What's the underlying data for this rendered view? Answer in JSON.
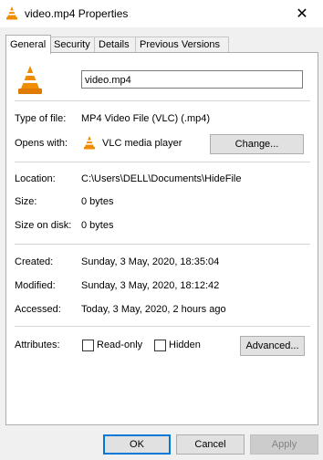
{
  "window": {
    "title": "video.mp4 Properties",
    "close_glyph": "✕"
  },
  "tabs": [
    {
      "label": "General",
      "active": true
    },
    {
      "label": "Security",
      "active": false
    },
    {
      "label": "Details",
      "active": false
    },
    {
      "label": "Previous Versions",
      "active": false
    }
  ],
  "general": {
    "file_name": "video.mp4",
    "type_label": "Type of file:",
    "type_value": "MP4 Video File (VLC) (.mp4)",
    "opens_label": "Opens with:",
    "opens_value": "VLC media player",
    "change_button": "Change...",
    "location_label": "Location:",
    "location_value": "C:\\Users\\DELL\\Documents\\HideFile",
    "size_label": "Size:",
    "size_value": "0 bytes",
    "size_on_disk_label": "Size on disk:",
    "size_on_disk_value": "0 bytes",
    "created_label": "Created:",
    "created_value": "Sunday, 3 May, 2020, 18:35:04",
    "modified_label": "Modified:",
    "modified_value": "Sunday, 3 May, 2020, 18:12:42",
    "accessed_label": "Accessed:",
    "accessed_value": "Today, 3 May, 2020, 2 hours ago",
    "attributes_label": "Attributes:",
    "readonly_label": "Read-only",
    "readonly_checked": false,
    "hidden_label": "Hidden",
    "hidden_checked": false,
    "advanced_button": "Advanced..."
  },
  "footer": {
    "ok": "OK",
    "cancel": "Cancel",
    "apply": "Apply"
  },
  "colors": {
    "vlc_orange": "#f08c00",
    "focus_blue": "#0078d7"
  },
  "icons": {
    "file_icon": "vlc-cone-icon",
    "app_icon": "vlc-cone-icon"
  }
}
